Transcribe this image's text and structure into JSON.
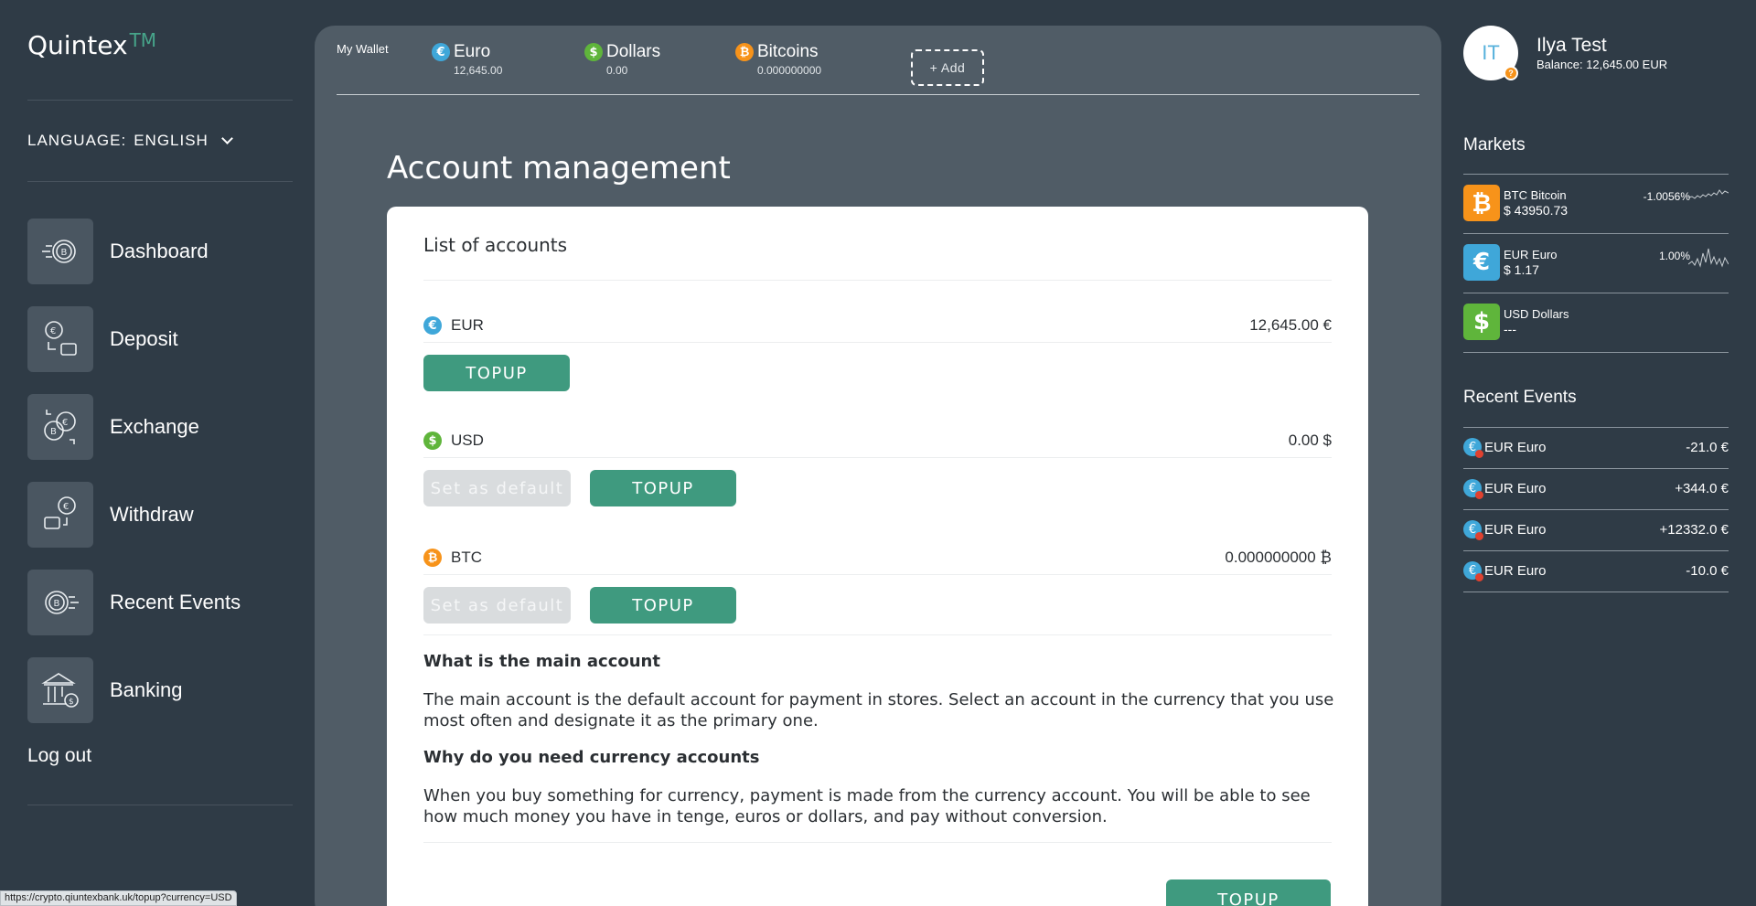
{
  "app": {
    "logo": "Quintex",
    "logo_tm": "TM"
  },
  "language": {
    "label": "LANGUAGE:",
    "value": "ENGLISH"
  },
  "nav": {
    "items": [
      {
        "label": "Dashboard",
        "icon": "dashboard-coin-icon"
      },
      {
        "label": "Deposit",
        "icon": "deposit-wallet-icon"
      },
      {
        "label": "Exchange",
        "icon": "exchange-coins-icon"
      },
      {
        "label": "Withdraw",
        "icon": "withdraw-wallet-icon"
      },
      {
        "label": "Recent Events",
        "icon": "recent-events-coin-icon"
      },
      {
        "label": "Banking",
        "icon": "bank-icon"
      }
    ],
    "logout": "Log out"
  },
  "wallet": {
    "title": "My Wallet",
    "items": [
      {
        "name": "Euro",
        "amount": "12,645.00",
        "symbol": "€",
        "color": "#3fa7d9"
      },
      {
        "name": "Dollars",
        "amount": "0.00",
        "symbol": "$",
        "color": "#5fb53b"
      },
      {
        "name": "Bitcoins",
        "amount": "0.000000000",
        "symbol": "₿",
        "color": "#f7931a"
      }
    ],
    "add_label": "+ Add"
  },
  "page": {
    "title": "Account management"
  },
  "accounts": {
    "heading": "List of accounts",
    "list": [
      {
        "code": "EUR",
        "amount": "12,645.00 €",
        "symbol": "€",
        "color": "#3fa7d9",
        "topup": "TOPUP"
      },
      {
        "code": "USD",
        "amount": "0.00 $",
        "symbol": "$",
        "color": "#5fb53b",
        "set_default": "Set as default",
        "topup": "TOPUP"
      },
      {
        "code": "BTC",
        "amount": "0.000000000 ₿",
        "symbol": "₿",
        "color": "#f7931a",
        "set_default": "Set as default",
        "topup": "TOPUP"
      }
    ],
    "main_h": "What is the main account",
    "main_p": "The main account is the default account for payment in stores. Select an account in the currency that you use most often and designate it as the primary one.",
    "why_h": "Why do you need currency accounts",
    "why_p": "When you buy something for currency, payment is made from the currency account. You will be able to see how much money you have in tenge, euros or dollars, and pay without conversion.",
    "bottom_topup": "TOPUP"
  },
  "user": {
    "initials": "IT",
    "name": "Ilya Test",
    "balance": "Balance: 12,645.00 EUR",
    "badge": "?"
  },
  "markets": {
    "title": "Markets",
    "items": [
      {
        "name": "BTC Bitcoin",
        "price": "$ 43950.73",
        "change": "-1.0056%",
        "symbol": "₿",
        "color": "#f7931a"
      },
      {
        "name": "EUR Euro",
        "price": "$ 1.17",
        "change": "1.00%",
        "symbol": "€",
        "color": "#3fa7d9"
      },
      {
        "name": "USD Dollars",
        "price": "---",
        "change": "",
        "symbol": "$",
        "color": "#5fb53b"
      }
    ]
  },
  "events": {
    "title": "Recent Events",
    "items": [
      {
        "name": "EUR Euro",
        "amount": "-21.0 €"
      },
      {
        "name": "EUR Euro",
        "amount": "+344.0 €"
      },
      {
        "name": "EUR Euro",
        "amount": "+12332.0 €"
      },
      {
        "name": "EUR Euro",
        "amount": "-10.0 €"
      }
    ]
  },
  "status_url": "https://crypto.qiuntexbank.uk/topup?currency=USD"
}
